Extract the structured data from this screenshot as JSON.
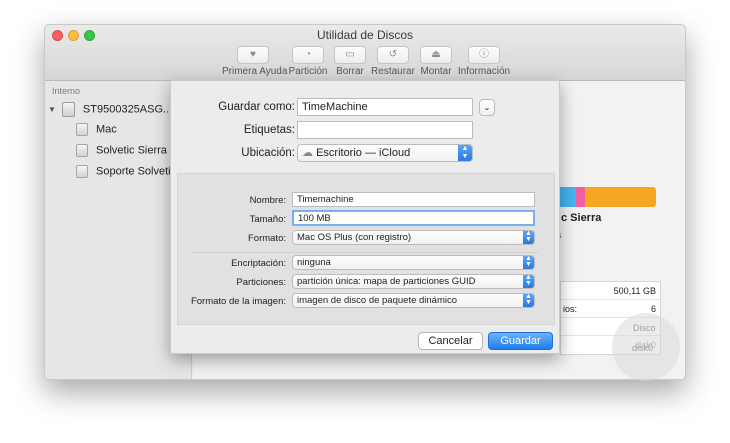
{
  "window": {
    "title": "Utilidad de Discos"
  },
  "toolbar": [
    {
      "label": "Primera Ayuda",
      "icon": "stethoscope-icon"
    },
    {
      "label": "Partición",
      "icon": "pie-icon"
    },
    {
      "label": "Borrar",
      "icon": "erase-icon"
    },
    {
      "label": "Restaurar",
      "icon": "restore-icon"
    },
    {
      "label": "Montar",
      "icon": "mount-icon"
    },
    {
      "label": "Información",
      "icon": "info-icon"
    }
  ],
  "sidebar": {
    "header": "Interno",
    "disk": "ST9500325ASG...",
    "volumes": [
      "Mac",
      "Solvetic Sierra",
      "Soporte Solvetic"
    ]
  },
  "main": {
    "volume_label": "c Sierra",
    "info_rows": [
      "500,11 GB",
      "ios:",
      "6",
      "disk0"
    ],
    "extra_glyph": "s",
    "bar_colors": [
      "#45b3f0",
      "#f25fa3",
      "#f5a623"
    ]
  },
  "sheet": {
    "save_as_label": "Guardar como:",
    "save_as_value": "TimeMachine",
    "tags_label": "Etiquetas:",
    "tags_value": "",
    "location_label": "Ubicación:",
    "location_value": "Escritorio — iCloud",
    "form": {
      "name_label": "Nombre:",
      "name_value": "Timemachine",
      "size_label": "Tamaño:",
      "size_value": "100 MB",
      "format_label": "Formato:",
      "format_value": "Mac OS Plus (con registro)",
      "encryption_label": "Encriptación:",
      "encryption_value": "ninguna",
      "partitions_label": "Particiones:",
      "partitions_value": "partición única: mapa de particiones GUID",
      "image_format_label": "Formato de la imagen:",
      "image_format_value": "imagen de disco de paquete dinámico"
    },
    "cancel": "Cancelar",
    "save": "Guardar"
  },
  "watermark": {
    "line1": "Disco",
    "line2": "disk0"
  }
}
